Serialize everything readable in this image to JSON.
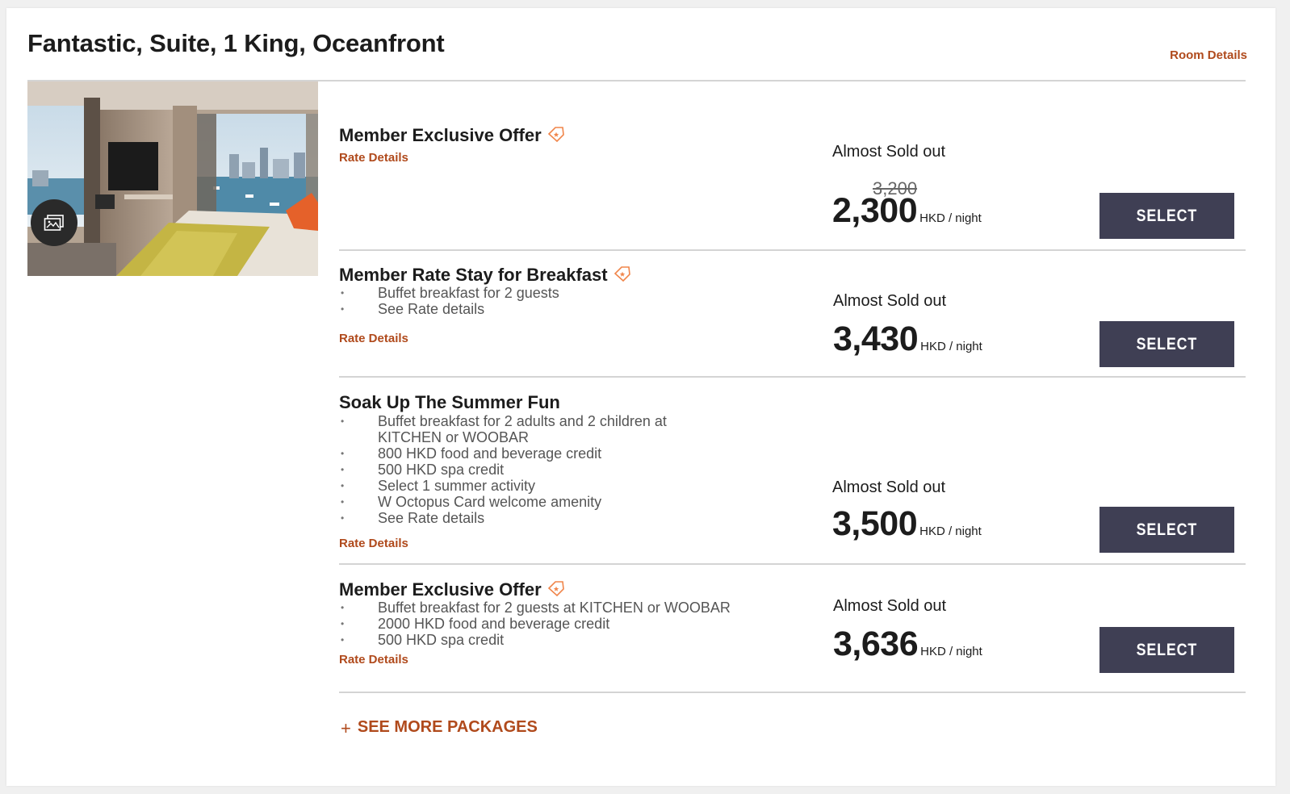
{
  "room": {
    "title": "Fantastic, Suite, 1 King, Oceanfront",
    "details_link": "Room Details"
  },
  "rates": [
    {
      "name": "Member Exclusive Offer",
      "has_member_tag": true,
      "benefits": [],
      "details_link": "Rate Details",
      "availability": "Almost Sold out",
      "original_price": "3,200",
      "price": "2,300",
      "unit": "HKD / night",
      "select_label": "SELECT"
    },
    {
      "name": "Member Rate Stay for Breakfast",
      "has_member_tag": true,
      "benefits": [
        "Buffet breakfast for 2 guests",
        "See Rate details"
      ],
      "details_link": "Rate Details",
      "availability": "Almost Sold out",
      "price": "3,430",
      "unit": "HKD / night",
      "select_label": "SELECT"
    },
    {
      "name": "Soak Up The Summer Fun",
      "has_member_tag": false,
      "benefits": [
        "Buffet breakfast for 2 adults and 2 children at KITCHEN or WOOBAR",
        "800 HKD food and beverage credit",
        "500 HKD spa credit",
        "Select 1 summer activity",
        "W Octopus Card welcome amenity",
        "See Rate details"
      ],
      "details_link": "Rate Details",
      "availability": "Almost Sold out",
      "price": "3,500",
      "unit": "HKD / night",
      "select_label": "SELECT"
    },
    {
      "name": "Member Exclusive Offer",
      "has_member_tag": true,
      "benefits": [
        "Buffet breakfast for 2 guests at KITCHEN or WOOBAR",
        "2000 HKD food and beverage credit",
        "500 HKD spa credit"
      ],
      "details_link": "Rate Details",
      "availability": "Almost Sold out",
      "price": "3,636",
      "unit": "HKD / night",
      "select_label": "SELECT"
    }
  ],
  "see_more": {
    "icon": "plus-icon",
    "label": "SEE MORE PACKAGES"
  },
  "colors": {
    "accent": "#b04a1c",
    "button": "#3f3f54",
    "divider": "#d4d4d4",
    "tag": "#f0854a"
  }
}
